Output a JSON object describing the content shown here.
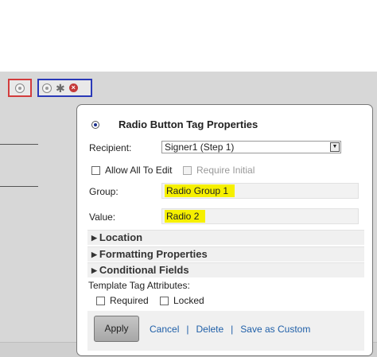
{
  "tags": {
    "red_tag_icon": "radio-icon",
    "blue_tag_icons": [
      "radio-icon",
      "gear-icon",
      "close-icon"
    ]
  },
  "dialog": {
    "title": "Radio Button Tag Properties",
    "recipient_label": "Recipient:",
    "recipient_value": "Signer1 (Step 1)",
    "allow_all_to_edit": "Allow All To Edit",
    "require_initial": "Require Initial",
    "group_label": "Group:",
    "group_value": "Radio Group 1",
    "value_label": "Value:",
    "value_value": "Radio 2",
    "sections": [
      "Location",
      "Formatting Properties",
      "Conditional Fields"
    ],
    "attributes_label": "Template Tag Attributes:",
    "required_label": "Required",
    "locked_label": "Locked",
    "apply_label": "Apply",
    "cancel_label": "Cancel",
    "delete_label": "Delete",
    "save_as_custom_label": "Save as Custom",
    "separator": "|"
  },
  "colors": {
    "highlight": "#f6f000",
    "link": "#1f5fa8",
    "red_border": "#d23c3c",
    "blue_border": "#2a39b8"
  }
}
